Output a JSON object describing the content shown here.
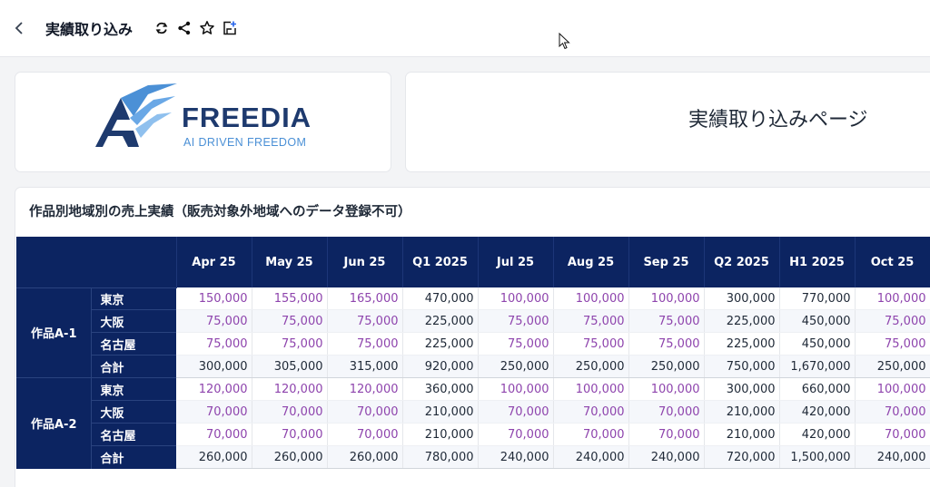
{
  "topbar": {
    "back_icon": "chevron-left-icon",
    "title": "実績取り込み",
    "icons": [
      "refresh-icon",
      "share-icon",
      "star-icon",
      "add-to-board-icon"
    ]
  },
  "logo": {
    "name": "FREEDIA",
    "tagline": "AI DRIVEN FREEDOM",
    "colors": {
      "dark": "#1e3a6e",
      "light": "#4b90d6"
    }
  },
  "heading": {
    "text": "実績取り込みページ"
  },
  "section": {
    "title": "作品別地域別の売上実績（販売対象外地域へのデータ登録不可）"
  },
  "table": {
    "columns": [
      "Apr 25",
      "May 25",
      "Jun 25",
      "Q1 2025",
      "Jul 25",
      "Aug 25",
      "Sep 25",
      "Q2 2025",
      "H1 2025",
      "Oct 25"
    ],
    "input_columns": [
      0,
      1,
      2,
      4,
      5,
      6,
      9
    ],
    "colors": {
      "header_bg": "#0c2461",
      "input_value": "#8e44ad"
    },
    "groups": [
      {
        "product": "作品A-1",
        "rows": [
          {
            "region": "東京",
            "values": [
              "150,000",
              "155,000",
              "165,000",
              "470,000",
              "100,000",
              "100,000",
              "100,000",
              "300,000",
              "770,000",
              "100,000"
            ]
          },
          {
            "region": "大阪",
            "values": [
              "75,000",
              "75,000",
              "75,000",
              "225,000",
              "75,000",
              "75,000",
              "75,000",
              "225,000",
              "450,000",
              "75,000"
            ]
          },
          {
            "region": "名古屋",
            "values": [
              "75,000",
              "75,000",
              "75,000",
              "225,000",
              "75,000",
              "75,000",
              "75,000",
              "225,000",
              "450,000",
              "75,000"
            ]
          },
          {
            "region": "合計",
            "total": true,
            "values": [
              "300,000",
              "305,000",
              "315,000",
              "920,000",
              "250,000",
              "250,000",
              "250,000",
              "750,000",
              "1,670,000",
              "250,000"
            ]
          }
        ]
      },
      {
        "product": "作品A-2",
        "rows": [
          {
            "region": "東京",
            "values": [
              "120,000",
              "120,000",
              "120,000",
              "360,000",
              "100,000",
              "100,000",
              "100,000",
              "300,000",
              "660,000",
              "100,000"
            ]
          },
          {
            "region": "大阪",
            "values": [
              "70,000",
              "70,000",
              "70,000",
              "210,000",
              "70,000",
              "70,000",
              "70,000",
              "210,000",
              "420,000",
              "70,000"
            ]
          },
          {
            "region": "名古屋",
            "values": [
              "70,000",
              "70,000",
              "70,000",
              "210,000",
              "70,000",
              "70,000",
              "70,000",
              "210,000",
              "420,000",
              "70,000"
            ]
          },
          {
            "region": "合計",
            "total": true,
            "values": [
              "260,000",
              "260,000",
              "260,000",
              "780,000",
              "240,000",
              "240,000",
              "240,000",
              "720,000",
              "1,500,000",
              "240,000"
            ]
          }
        ]
      }
    ]
  }
}
